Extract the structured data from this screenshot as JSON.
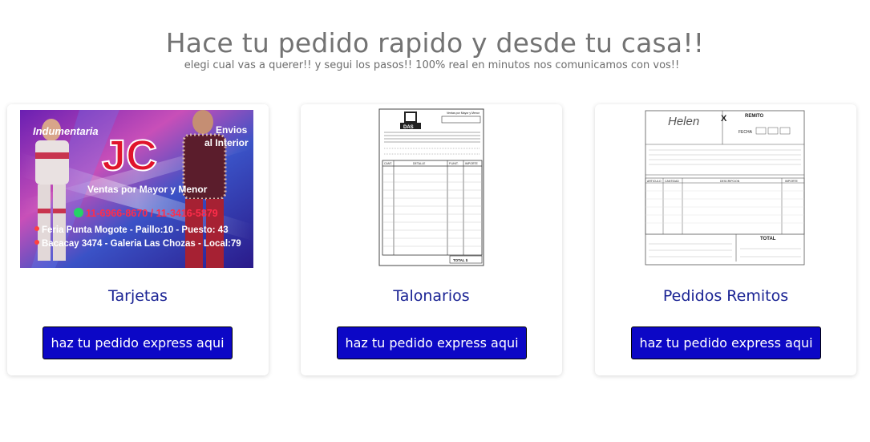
{
  "hero": {
    "title": "Hace tu pedido rapido y desde tu casa!!",
    "subtitle": "elegi cual vas a querer!! y segui los pasos!! 100% real en minutos nos comunicamos con vos!!"
  },
  "products": [
    {
      "name": "Tarjetas",
      "button": "haz tu pedido express aqui",
      "image_text": {
        "brand_top": "Indumentaria",
        "logo": "JC",
        "envios": "Envios",
        "envios2": "al Interior",
        "tagline": "Ventas por Mayor y Menor",
        "phones": "11-6966-8670 / 11-3416-5879",
        "address1": "Feria Punta Mogote - Paillo:10 - Puesto: 43",
        "address2": "Bacacay 3474 - Galeria Las Chozas - Local:79"
      }
    },
    {
      "name": "Talonarios",
      "button": "haz tu pedido express aqui",
      "image_text": {
        "brand": "DAS",
        "header_right": "Ventas por Mayor y Menor",
        "col1": "CANT.",
        "col2": "DETALLE",
        "col3": "P.UNIT.",
        "col4": "IMPORTE",
        "total": "TOTAL $"
      }
    },
    {
      "name": "Pedidos Remitos",
      "button": "haz tu pedido express aqui",
      "image_text": {
        "brand": "Helen",
        "doc_type": "X",
        "doc_title": "REMITO",
        "fecha": "FECHA",
        "total": "TOTAL",
        "col1": "ARTICULO",
        "col2": "CANTIDAD",
        "col3": "DESCRIPCION",
        "col4": "IMPORTE"
      }
    }
  ],
  "colors": {
    "button_bg": "#0c07c6",
    "product_name": "#1a2394",
    "title": "#737373"
  }
}
